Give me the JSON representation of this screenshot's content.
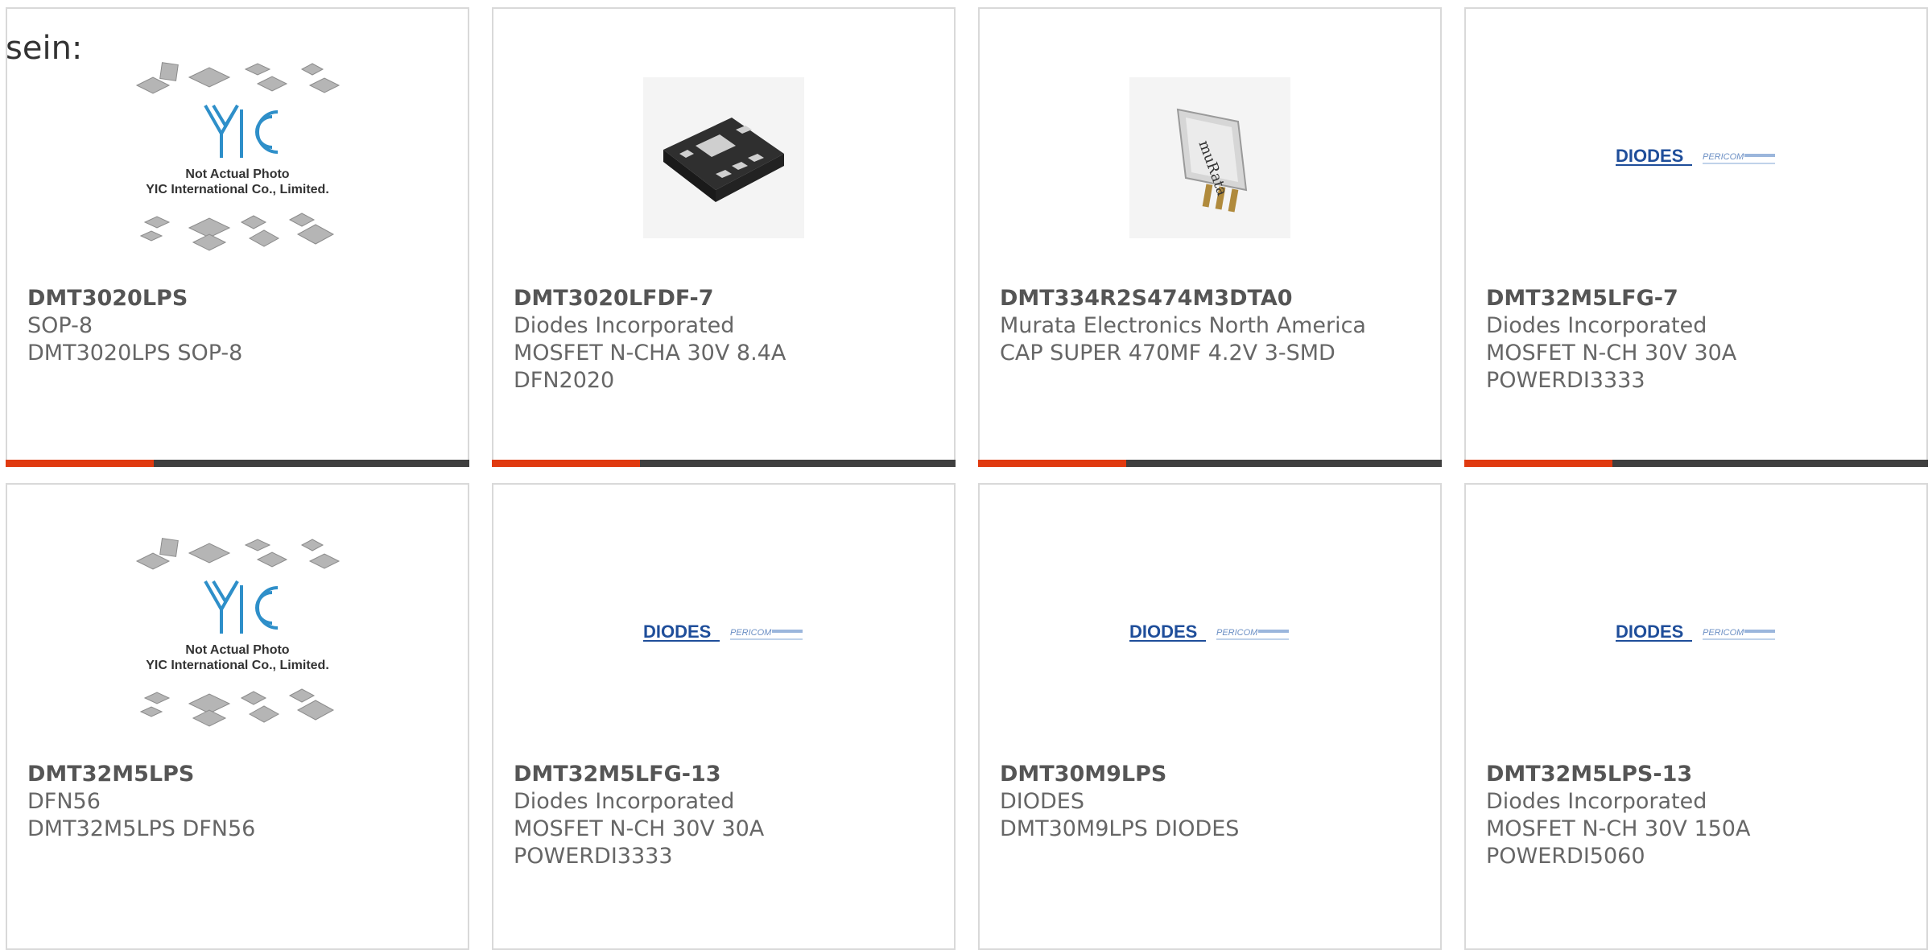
{
  "intro_text": "sein:",
  "colors": {
    "accent": "#e03a10",
    "bar_dark": "#3f3f3f",
    "border": "#d9d9d9",
    "diodes_blue": "#1f4e9a",
    "yic_blue": "#2e8fc9"
  },
  "placeholder": {
    "line1": "Not Actual Photo",
    "line2": "YIC International Co., Limited.",
    "logo_text": "YIC"
  },
  "diodes_logo": {
    "brand": "DIODES",
    "sub": "PERICOM"
  },
  "products": [
    {
      "part": "DMT3020LPS",
      "lines": [
        "SOP-8",
        "DMT3020LPS SOP-8"
      ],
      "image": "not-actual-photo"
    },
    {
      "part": "DMT3020LFDF-7",
      "lines": [
        "Diodes Incorporated",
        "MOSFET N-CHA 30V 8.4A",
        "DFN2020"
      ],
      "image": "chip-photo"
    },
    {
      "part": "DMT334R2S474M3DTA0",
      "lines": [
        "Murata Electronics North America",
        "CAP SUPER 470MF 4.2V 3-SMD"
      ],
      "image": "supercap-photo"
    },
    {
      "part": "DMT32M5LFG-7",
      "lines": [
        "Diodes Incorporated",
        "MOSFET N-CH 30V 30A",
        "POWERDI3333"
      ],
      "image": "diodes-logo"
    },
    {
      "part": "DMT32M5LPS",
      "lines": [
        "DFN56",
        "DMT32M5LPS DFN56"
      ],
      "image": "not-actual-photo"
    },
    {
      "part": "DMT32M5LFG-13",
      "lines": [
        "Diodes Incorporated",
        "MOSFET N-CH 30V 30A",
        "POWERDI3333"
      ],
      "image": "diodes-logo"
    },
    {
      "part": "DMT30M9LPS",
      "lines": [
        "DIODES",
        "DMT30M9LPS DIODES"
      ],
      "image": "diodes-logo"
    },
    {
      "part": "DMT32M5LPS-13",
      "lines": [
        "Diodes Incorporated",
        "MOSFET N-CH 30V 150A",
        "POWERDI5060"
      ],
      "image": "diodes-logo"
    }
  ]
}
